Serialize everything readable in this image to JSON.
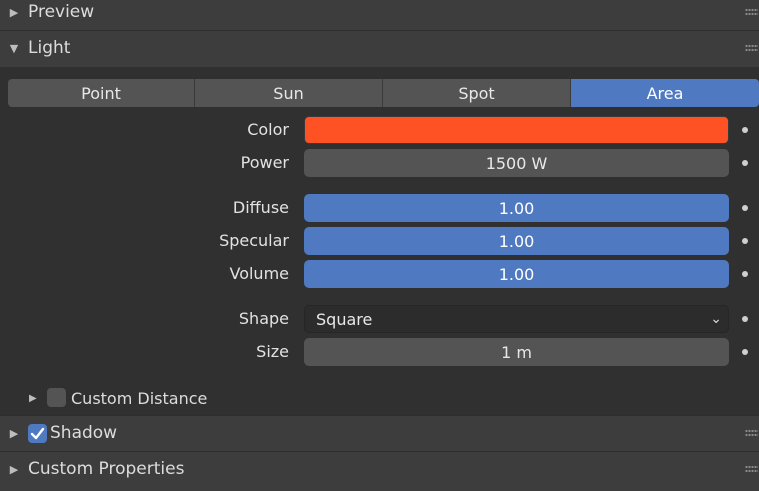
{
  "panels": {
    "preview": {
      "title": "Preview",
      "expanded": false
    },
    "light": {
      "title": "Light",
      "expanded": true
    },
    "shadow": {
      "title": "Shadow",
      "enabled": true,
      "expanded": false
    },
    "custom_properties": {
      "title": "Custom Properties",
      "expanded": false
    }
  },
  "light_type": {
    "options": [
      "Point",
      "Sun",
      "Spot",
      "Area"
    ],
    "selected": "Area"
  },
  "properties": {
    "color": {
      "label": "Color",
      "value": "#ff5224"
    },
    "power": {
      "label": "Power",
      "value": "1500 W"
    },
    "diffuse": {
      "label": "Diffuse",
      "value": "1.00"
    },
    "specular": {
      "label": "Specular",
      "value": "1.00"
    },
    "volume": {
      "label": "Volume",
      "value": "1.00"
    },
    "shape": {
      "label": "Shape",
      "value": "Square"
    },
    "size": {
      "label": "Size",
      "value": "1 m"
    }
  },
  "custom_distance": {
    "label": "Custom Distance",
    "enabled": false
  },
  "colors": {
    "accent": "#4f79c0",
    "light_color": "#ff5224",
    "panel_bg": "#3d3d3d",
    "body_bg": "#303030"
  },
  "icons": {
    "collapsed": "triangle-right-icon",
    "expanded": "triangle-down-icon",
    "drag": "drag-handle-icon",
    "keyframe": "keyframe-dot-icon",
    "dropdown": "chevron-down-icon",
    "check": "checkmark-icon"
  }
}
